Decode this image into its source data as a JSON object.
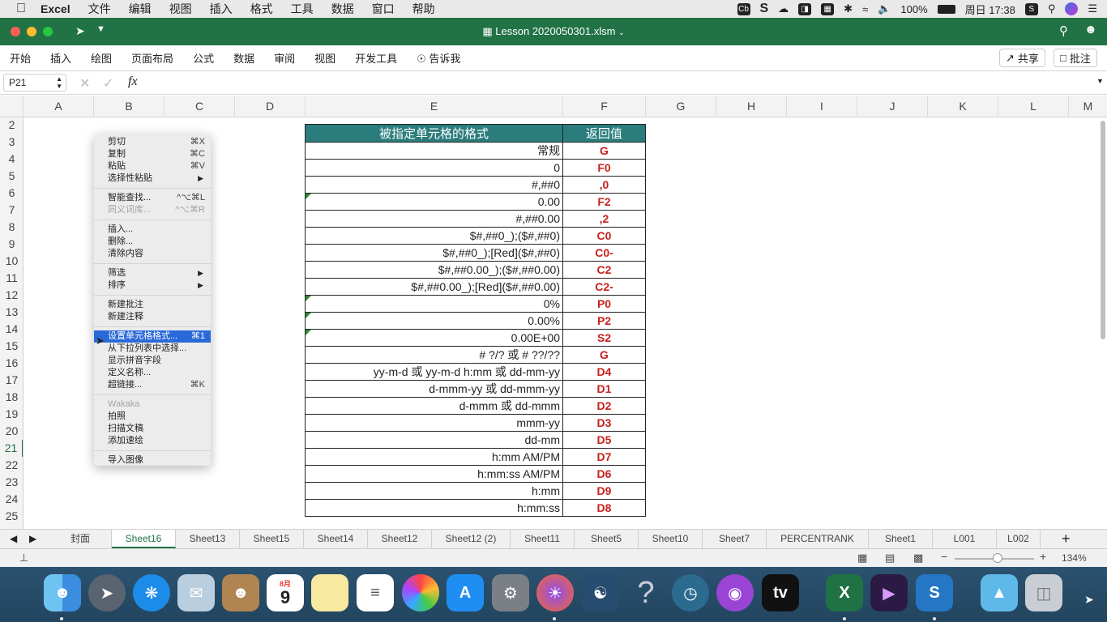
{
  "menubar": {
    "app": "Excel",
    "items": [
      "文件",
      "编辑",
      "视图",
      "插入",
      "格式",
      "工具",
      "数据",
      "窗口",
      "帮助"
    ],
    "battery": "100%",
    "clock": "周日 17:38"
  },
  "window": {
    "title": "Lesson 2020050301.xlsm"
  },
  "ribbon": {
    "tabs": [
      "开始",
      "插入",
      "绘图",
      "页面布局",
      "公式",
      "数据",
      "审阅",
      "视图",
      "开发工具"
    ],
    "tell_me": "告诉我",
    "share": "共享",
    "comments": "批注"
  },
  "formula_bar": {
    "name_box": "P21",
    "fx": "fx",
    "value": ""
  },
  "columns": [
    "A",
    "B",
    "C",
    "D",
    "E",
    "F",
    "G",
    "H",
    "I",
    "J",
    "K",
    "L",
    "M"
  ],
  "rows": [
    "2",
    "3",
    "4",
    "5",
    "6",
    "7",
    "8",
    "9",
    "10",
    "11",
    "12",
    "13",
    "14",
    "15",
    "16",
    "17",
    "18",
    "19",
    "20",
    "21",
    "22",
    "23",
    "24",
    "25"
  ],
  "table": {
    "header_e": "被指定单元格的格式",
    "header_f": "返回值",
    "rows": [
      {
        "e": "常规",
        "f": "G",
        "tri": false
      },
      {
        "e": "0",
        "f": "F0",
        "tri": false
      },
      {
        "e": "#,##0",
        "f": ",0",
        "tri": false
      },
      {
        "e": "0.00",
        "f": "F2",
        "tri": true
      },
      {
        "e": "#,##0.00",
        "f": ",2",
        "tri": false
      },
      {
        "e": "$#,##0_);($#,##0)",
        "f": "C0",
        "tri": false
      },
      {
        "e": "$#,##0_);[Red]($#,##0)",
        "f": "C0-",
        "tri": false
      },
      {
        "e": "$#,##0.00_);($#,##0.00)",
        "f": "C2",
        "tri": false
      },
      {
        "e": "$#,##0.00_);[Red]($#,##0.00)",
        "f": "C2-",
        "tri": false
      },
      {
        "e": "0%",
        "f": "P0",
        "tri": true
      },
      {
        "e": "0.00%",
        "f": "P2",
        "tri": true
      },
      {
        "e": "0.00E+00",
        "f": "S2",
        "tri": true
      },
      {
        "e": "# ?/? 或 # ??/??",
        "f": "G",
        "tri": false
      },
      {
        "e": "yy-m-d 或 yy-m-d h:mm 或 dd-mm-yy",
        "f": "D4",
        "tri": false
      },
      {
        "e": "d-mmm-yy 或 dd-mmm-yy",
        "f": "D1",
        "tri": false
      },
      {
        "e": "d-mmm 或 dd-mmm",
        "f": "D2",
        "tri": false
      },
      {
        "e": "mmm-yy",
        "f": "D3",
        "tri": false
      },
      {
        "e": "dd-mm",
        "f": "D5",
        "tri": false
      },
      {
        "e": "h:mm AM/PM",
        "f": "D7",
        "tri": false
      },
      {
        "e": "h:mm:ss AM/PM",
        "f": "D6",
        "tri": false
      },
      {
        "e": "h:mm",
        "f": "D9",
        "tri": false
      },
      {
        "e": "h:mm:ss",
        "f": "D8",
        "tri": false
      }
    ]
  },
  "context_menu": [
    {
      "type": "item",
      "label": "剪切",
      "key": "⌘X"
    },
    {
      "type": "item",
      "label": "复制",
      "key": "⌘C"
    },
    {
      "type": "item",
      "label": "粘贴",
      "key": "⌘V"
    },
    {
      "type": "item",
      "label": "选择性粘贴",
      "sub": true
    },
    {
      "type": "sep"
    },
    {
      "type": "item",
      "label": "智能查找...",
      "key": "^⌥⌘L"
    },
    {
      "type": "item",
      "label": "同义词库...",
      "key": "^⌥⌘R",
      "disabled": true
    },
    {
      "type": "sep"
    },
    {
      "type": "item",
      "label": "插入..."
    },
    {
      "type": "item",
      "label": "删除..."
    },
    {
      "type": "item",
      "label": "清除内容"
    },
    {
      "type": "sep"
    },
    {
      "type": "item",
      "label": "筛选",
      "sub": true
    },
    {
      "type": "item",
      "label": "排序",
      "sub": true
    },
    {
      "type": "sep"
    },
    {
      "type": "item",
      "label": "新建批注"
    },
    {
      "type": "item",
      "label": "新建注释"
    },
    {
      "type": "sep"
    },
    {
      "type": "item",
      "label": "设置单元格格式...",
      "key": "⌘1",
      "selected": true
    },
    {
      "type": "item",
      "label": "从下拉列表中选择..."
    },
    {
      "type": "item",
      "label": "显示拼音字段"
    },
    {
      "type": "item",
      "label": "定义名称..."
    },
    {
      "type": "item",
      "label": "超链接...",
      "key": "⌘K"
    },
    {
      "type": "sep"
    },
    {
      "type": "item",
      "label": "Wakaka",
      "disabled": true
    },
    {
      "type": "item",
      "label": "拍照"
    },
    {
      "type": "item",
      "label": "扫描文稿"
    },
    {
      "type": "item",
      "label": "添加速绘"
    },
    {
      "type": "sep"
    },
    {
      "type": "item",
      "label": "导入图像"
    }
  ],
  "sheet_tabs": [
    "封面",
    "Sheet16",
    "Sheet13",
    "Sheet15",
    "Sheet14",
    "Sheet12",
    "Sheet12 (2)",
    "Sheet11",
    "Sheet5",
    "Sheet10",
    "Sheet7",
    "PERCENTRANK",
    "Sheet1",
    "L001",
    "L002"
  ],
  "active_sheet": "Sheet16",
  "status": {
    "zoom": "134%"
  },
  "dock": [
    "finder",
    "launchpad",
    "safari",
    "mail-eagle",
    "contacts",
    "calendar",
    "notes",
    "reminders",
    "photos",
    "app-store",
    "system-preferences",
    "firefox",
    "mysql-workbench",
    "help",
    "time-machine",
    "podcasts",
    "apple-tv",
    "excel",
    "video-app",
    "snagit",
    "downloads-folder",
    "trash"
  ],
  "calendar_day": "9",
  "calendar_month": "8月"
}
